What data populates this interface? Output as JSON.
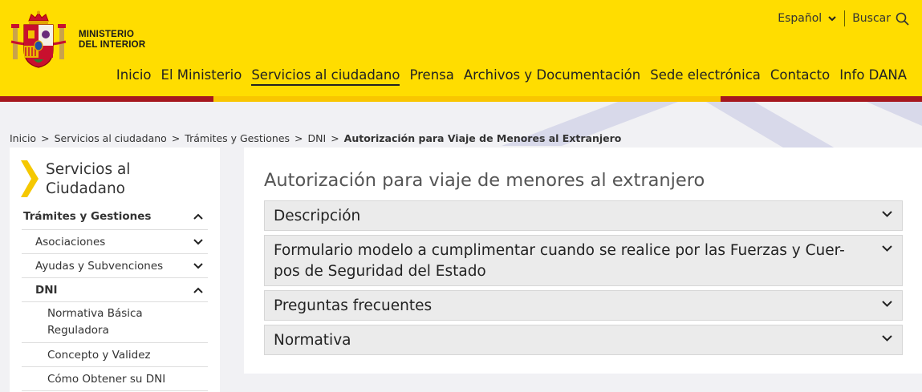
{
  "header": {
    "ministry_line1": "MINISTERIO",
    "ministry_line2": "DEL INTERIOR",
    "language": "Español",
    "search_label": "Buscar",
    "nav": [
      {
        "label": "Inicio",
        "active": false
      },
      {
        "label": "El Ministerio",
        "active": false
      },
      {
        "label": "Servicios al ciudadano",
        "active": true
      },
      {
        "label": "Prensa",
        "active": false
      },
      {
        "label": "Archivos y Documentación",
        "active": false
      },
      {
        "label": "Sede electrónica",
        "active": false
      },
      {
        "label": "Contacto",
        "active": false
      },
      {
        "label": "Info DANA",
        "active": false
      }
    ]
  },
  "breadcrumb": {
    "items": [
      "Inicio",
      "Servicios al ciudadano",
      "Trámites y Gestiones",
      "DNI"
    ],
    "current": "Autorización para Viaje de Menores al Extranjero",
    "separator": ">"
  },
  "sidebar": {
    "title_line1": "Servicios al",
    "title_line2": "Ciudadano",
    "items": [
      {
        "label": "Trámites y Gestiones",
        "state": "expanded"
      },
      {
        "label": "Asociaciones",
        "state": "collapsed"
      },
      {
        "label": "Ayudas y Subvenciones",
        "state": "collapsed"
      },
      {
        "label": "DNI",
        "state": "expanded"
      },
      {
        "label": "Normativa Básica Reguladora",
        "state": "none"
      },
      {
        "label": "Concepto y Validez",
        "state": "none"
      },
      {
        "label": "Cómo Obtener su DNI",
        "state": "none"
      }
    ]
  },
  "main": {
    "title": "Autorización para viaje de menores al extranjero",
    "accordion": [
      {
        "line1": "Descripción",
        "line2": ""
      },
      {
        "line1": "Formulario modelo a cumplimentar cuando se realice por las Fuerzas y Cuer-",
        "line2": "pos de Seguridad del Estado"
      },
      {
        "line1": "Preguntas frecuentes",
        "line2": ""
      },
      {
        "line1": "Normativa",
        "line2": ""
      }
    ]
  },
  "colors": {
    "brand_yellow": "#ffdd00",
    "brand_red": "#a5171e",
    "stripe_yellow": "#f9c600",
    "accent_arrow": "#f5c800",
    "deco": "#d8d9ea"
  }
}
